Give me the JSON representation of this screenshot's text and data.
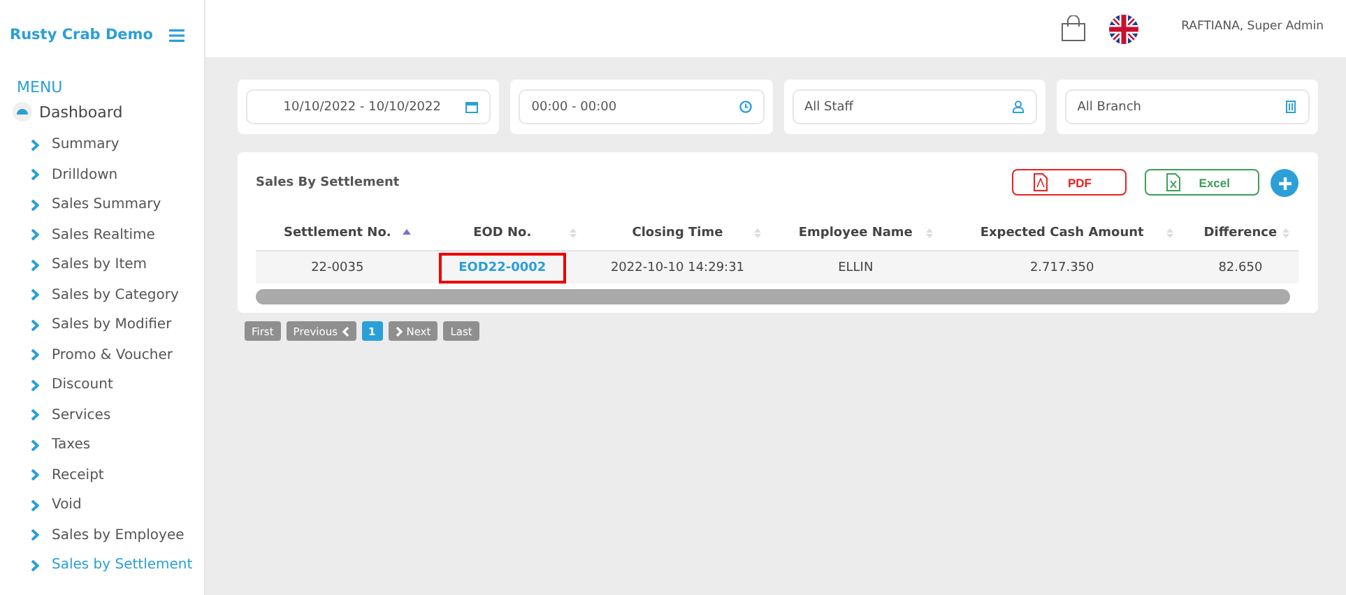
{
  "sidebar": {
    "brand": "Rusty Crab Demo",
    "menu_label": "MENU",
    "dashboard": "Dashboard",
    "items": [
      {
        "label": "Summary",
        "selected": false
      },
      {
        "label": "Drilldown",
        "selected": false
      },
      {
        "label": "Sales Summary",
        "selected": false
      },
      {
        "label": "Sales Realtime",
        "selected": false
      },
      {
        "label": "Sales by Item",
        "selected": false
      },
      {
        "label": "Sales by Category",
        "selected": false
      },
      {
        "label": "Sales by Modifier",
        "selected": false
      },
      {
        "label": "Promo & Voucher",
        "selected": false
      },
      {
        "label": "Discount",
        "selected": false
      },
      {
        "label": "Services",
        "selected": false
      },
      {
        "label": "Taxes",
        "selected": false
      },
      {
        "label": "Receipt",
        "selected": false
      },
      {
        "label": "Void",
        "selected": false
      },
      {
        "label": "Sales by Employee",
        "selected": false
      },
      {
        "label": "Sales by Settlement",
        "selected": true
      }
    ]
  },
  "header": {
    "user": "RAFTIANA, Super Admin"
  },
  "filters": [
    {
      "kind": "date",
      "value": "10/10/2022 - 10/10/2022"
    },
    {
      "kind": "time",
      "value": "00:00 - 00:00"
    },
    {
      "kind": "staff",
      "value": "All Staff"
    },
    {
      "kind": "branch",
      "value": "All Branch"
    }
  ],
  "report": {
    "title": "Sales By Settlement",
    "buttons": [
      {
        "kind": "pdf",
        "label": "PDF"
      },
      {
        "kind": "excel",
        "label": "Excel"
      },
      {
        "kind": "add"
      }
    ],
    "columns": [
      {
        "label": "Settlement No.",
        "sorted": true
      },
      {
        "label": "EOD No.",
        "sorted": false
      },
      {
        "label": "Closing Time",
        "sorted": false
      },
      {
        "label": "Employee Name",
        "sorted": false
      },
      {
        "label": "Expected Cash Amount",
        "sorted": false
      },
      {
        "label": "Difference",
        "sorted": false
      }
    ],
    "rows": [
      {
        "cells": [
          {
            "text": "22-0035",
            "kind": "text",
            "highlighted": false
          },
          {
            "text": "EOD22-0002",
            "kind": "link",
            "highlighted": true
          },
          {
            "text": "2022-10-10 14:29:31",
            "kind": "text",
            "highlighted": false
          },
          {
            "text": "ELLIN",
            "kind": "text",
            "highlighted": false
          },
          {
            "text": "2.717.350",
            "kind": "text",
            "highlighted": false
          },
          {
            "text": "82.650",
            "kind": "text",
            "highlighted": false
          }
        ]
      }
    ]
  },
  "pagination": [
    {
      "kind": "first",
      "label": "First",
      "disabled": true,
      "selected": false
    },
    {
      "kind": "prev",
      "label": "Previous",
      "disabled": true,
      "selected": false
    },
    {
      "kind": "page",
      "label": "1",
      "disabled": false,
      "selected": true
    },
    {
      "kind": "next",
      "label": "Next",
      "disabled": true,
      "selected": false
    },
    {
      "kind": "last",
      "label": "Last",
      "disabled": true,
      "selected": false
    }
  ]
}
